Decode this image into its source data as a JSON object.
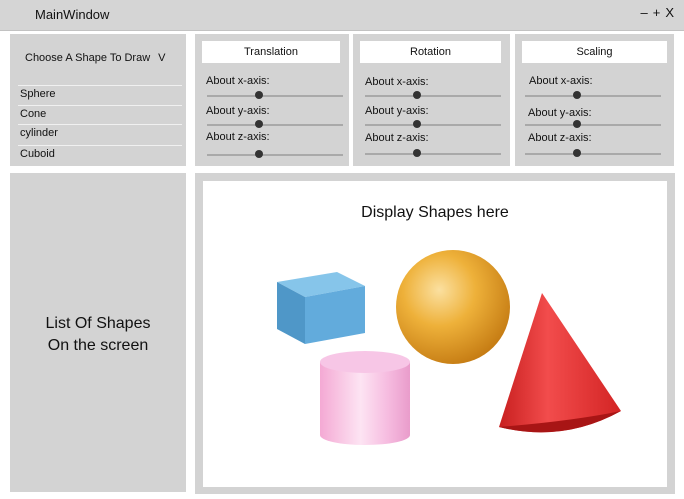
{
  "window": {
    "title": "MainWindow",
    "controls": {
      "minimize": "–",
      "maximize": "+",
      "close": "X"
    }
  },
  "shape_chooser": {
    "label": "Choose A Shape To Draw",
    "chevron": "V",
    "options": [
      "Sphere",
      "Cone",
      "cylinder",
      "Cuboid"
    ]
  },
  "transforms": [
    {
      "title": "Translation",
      "axes": [
        {
          "label": "About x-axis:",
          "value": 0.38
        },
        {
          "label": "About y-axis:",
          "value": 0.38
        },
        {
          "label": "About z-axis:",
          "value": 0.38
        }
      ]
    },
    {
      "title": "Rotation",
      "axes": [
        {
          "label": "About x-axis:",
          "value": 0.38
        },
        {
          "label": "About y-axis:",
          "value": 0.38
        },
        {
          "label": "About z-axis:",
          "value": 0.38
        }
      ]
    },
    {
      "title": "Scaling",
      "axes": [
        {
          "label": "About x-axis:",
          "value": 0.38
        },
        {
          "label": "About y-axis:",
          "value": 0.38
        },
        {
          "label": "About z-axis:",
          "value": 0.38
        }
      ]
    }
  ],
  "list_panel": {
    "text": "List Of Shapes\nOn the screen"
  },
  "display": {
    "title": "Display Shapes here",
    "shapes": [
      "cuboid",
      "sphere",
      "cylinder",
      "cone"
    ]
  },
  "colors": {
    "panel": "#d3d3d3",
    "cuboid": "#5fa9d9",
    "sphere": "#e8a628",
    "cylinder": "#f5b9de",
    "cone": "#e83535"
  }
}
